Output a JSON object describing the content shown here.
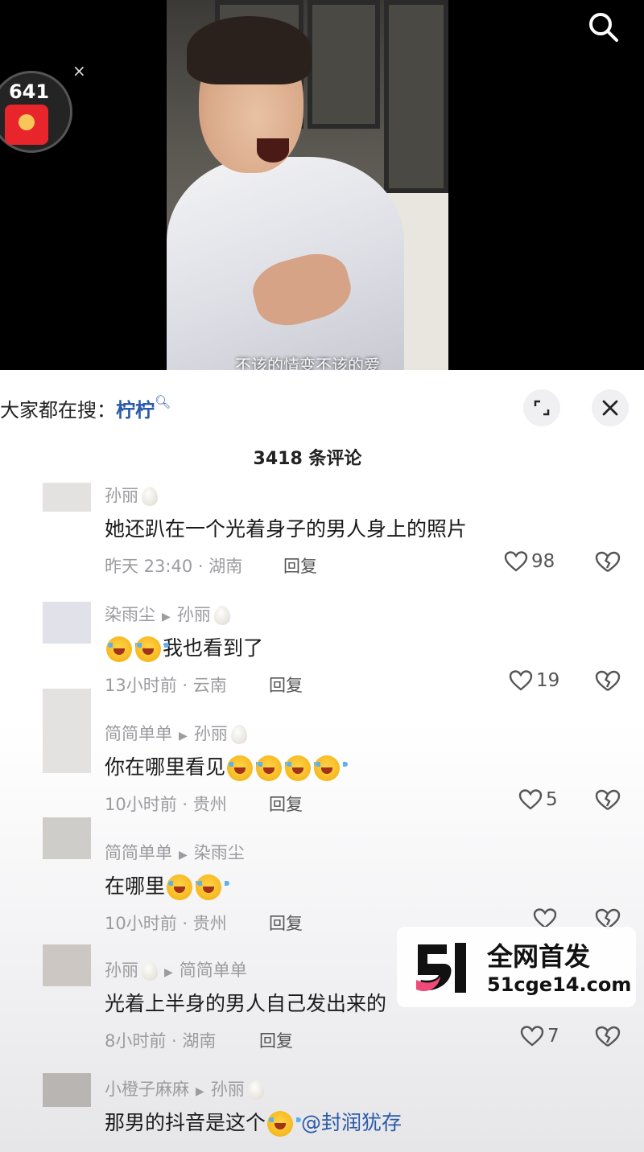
{
  "video": {
    "subtitle": "不该的情变不该的爱",
    "red_packet_count": "641",
    "red_packet_close": "×"
  },
  "search_hint": {
    "prefix": "大家都在搜：",
    "keyword": "柠柠"
  },
  "comment_count": "3418 条评论",
  "comments": [
    {
      "user": "孙丽",
      "reply_to": "",
      "text": "她还趴在一个光着身子的男人身上的照片",
      "meta": "昨天 23:40 · 湖南",
      "reply": "回复",
      "likes": "98"
    },
    {
      "user": "染雨尘",
      "reply_to": "孙丽",
      "text": "我也看到了",
      "meta": "13小时前 · 云南",
      "reply": "回复",
      "likes": "19"
    },
    {
      "user": "简简单单",
      "reply_to": "孙丽",
      "text": "你在哪里看见",
      "meta": "10小时前 · 贵州",
      "reply": "回复",
      "likes": "5"
    },
    {
      "user": "简简单单",
      "reply_to": "染雨尘",
      "text": "在哪里",
      "meta": "10小时前 · 贵州",
      "reply": "回复",
      "likes": ""
    },
    {
      "user": "孙丽",
      "reply_to": "简简单单",
      "text": "光着上半身的男人自己发出来的",
      "meta": "8小时前 · 湖南",
      "reply": "回复",
      "likes": "7"
    },
    {
      "user": "小橙子麻麻",
      "reply_to": "孙丽",
      "text": "那男的抖音是这个",
      "mention": "@封润犹存",
      "meta": "",
      "reply": "",
      "likes": ""
    }
  ],
  "watermark": {
    "title": "全网首发",
    "url": "51cge14.com"
  },
  "colors": {
    "link": "#2a5aa8",
    "muted": "#9b9ba0",
    "panel_bg": "#ffffff"
  }
}
